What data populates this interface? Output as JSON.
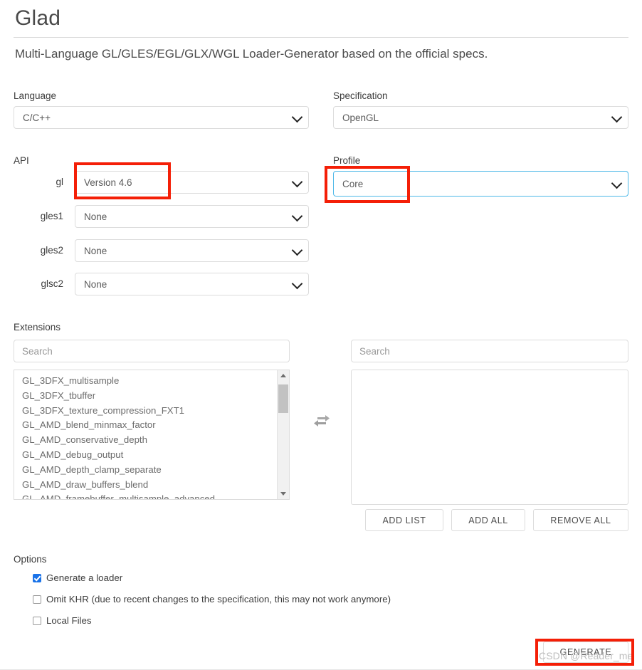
{
  "header": {
    "title": "Glad",
    "subtitle": "Multi-Language GL/GLES/EGL/GLX/WGL Loader-Generator based on the official specs."
  },
  "language": {
    "label": "Language",
    "value": "C/C++"
  },
  "specification": {
    "label": "Specification",
    "value": "OpenGL"
  },
  "api": {
    "label": "API",
    "rows": [
      {
        "name": "gl",
        "value": "Version 4.6"
      },
      {
        "name": "gles1",
        "value": "None"
      },
      {
        "name": "gles2",
        "value": "None"
      },
      {
        "name": "glsc2",
        "value": "None"
      }
    ]
  },
  "profile": {
    "label": "Profile",
    "value": "Core"
  },
  "extensions": {
    "label": "Extensions",
    "search_placeholder": "Search",
    "available": [
      "GL_3DFX_multisample",
      "GL_3DFX_tbuffer",
      "GL_3DFX_texture_compression_FXT1",
      "GL_AMD_blend_minmax_factor",
      "GL_AMD_conservative_depth",
      "GL_AMD_debug_output",
      "GL_AMD_depth_clamp_separate",
      "GL_AMD_draw_buffers_blend",
      "GL_AMD_framebuffer_multisample_advanced"
    ],
    "selected_search_placeholder": "Search",
    "selected": [],
    "swap_icon": "swap-horizontal-icon",
    "buttons": {
      "add_list": "ADD LIST",
      "add_all": "ADD ALL",
      "remove_all": "REMOVE ALL"
    }
  },
  "options": {
    "label": "Options",
    "items": [
      {
        "label": "Generate a loader",
        "checked": true
      },
      {
        "label": "Omit KHR (due to recent changes to the specification, this may not work anymore)",
        "checked": false
      },
      {
        "label": "Local Files",
        "checked": false
      }
    ]
  },
  "generate": {
    "label": "GENERATE"
  },
  "watermark": {
    "text": "CSDN @Reader_me"
  },
  "annotations": {
    "accent_color": "#f41f07",
    "focus_color": "#4db8e8"
  }
}
